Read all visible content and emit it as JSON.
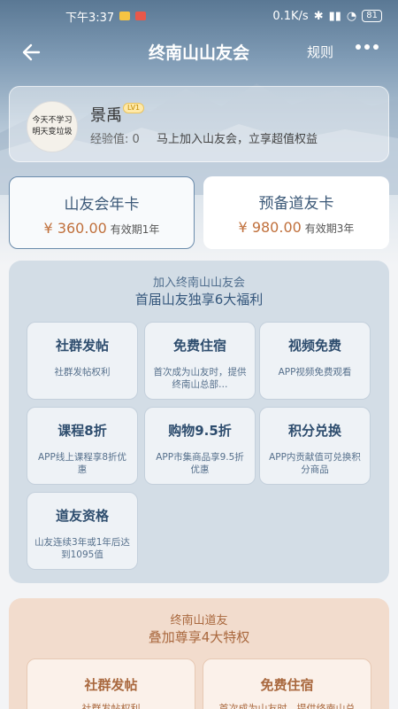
{
  "status_bar": {
    "time": "下午3:37",
    "net_speed": "0.1K/s",
    "battery": "81"
  },
  "nav": {
    "title": "终南山山友会",
    "rules_label": "规则"
  },
  "user": {
    "name": "景禹",
    "level": "LV1",
    "exp_text": "经验值: 0",
    "cta": "马上加入山友会，立享超值权益",
    "avatar_lines": [
      "今天不学习",
      "明天变垃圾"
    ]
  },
  "plans": [
    {
      "name": "山友会年卡",
      "price": "¥ 360.00",
      "period": "有效期1年"
    },
    {
      "name": "预备道友卡",
      "price": "¥ 980.00",
      "period": "有效期3年"
    }
  ],
  "benefits_section": {
    "subtitle": "加入终南山山友会",
    "title": "首届山友独享6大福利",
    "items": [
      {
        "title": "社群发帖",
        "desc": "社群发帖权利"
      },
      {
        "title": "免费住宿",
        "desc": "首次成为山友时，提供终南山总部…"
      },
      {
        "title": "视频免费",
        "desc": "APP视频免费观看"
      },
      {
        "title": "课程8折",
        "desc": "APP线上课程享8折优惠"
      },
      {
        "title": "购物9.5折",
        "desc": "APP市集商品享9.5折优惠"
      },
      {
        "title": "积分兑换",
        "desc": "APP内贡献值可兑换积分商品"
      },
      {
        "title": "道友资格",
        "desc": "山友连续3年或1年后达到1095值"
      }
    ]
  },
  "premium_section": {
    "subtitle": "终南山道友",
    "title": "叠加尊享4大特权",
    "items": [
      {
        "title": "社群发帖",
        "desc": "社群发帖权利"
      },
      {
        "title": "免费住宿",
        "desc": "首次成为山友时，提供终南山总"
      }
    ]
  },
  "colors": {
    "accent": "#3c5978",
    "price": "#c0703c",
    "premium": "#a9683e"
  }
}
